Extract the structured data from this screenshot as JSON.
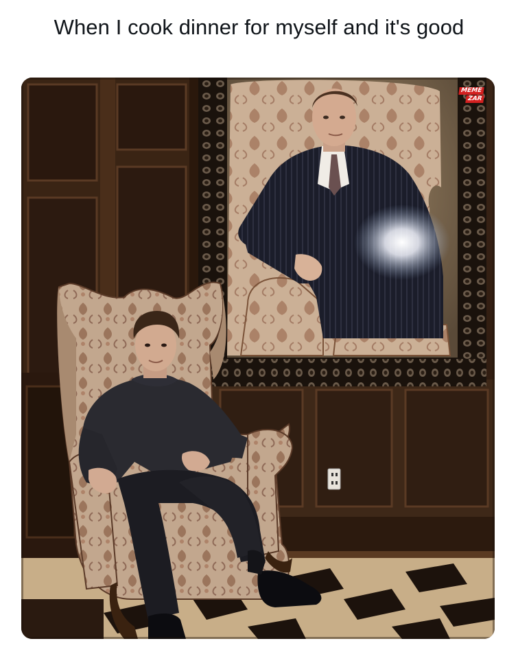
{
  "caption": "When I cook dinner for myself and it's good",
  "watermark": {
    "line1": "MEME",
    "line2": "ZAR"
  },
  "photo": {
    "subject": "man in dark clothes seated in a patterned armchair in front of a large framed portrait of himself",
    "colors": {
      "wood_dark": "#2a1a10",
      "wood_mid": "#4a3020",
      "chair_fabric": "#b89a80",
      "suit": "#1a1c28",
      "floor_light": "#d8c2a0",
      "floor_dark": "#1c120c"
    }
  }
}
